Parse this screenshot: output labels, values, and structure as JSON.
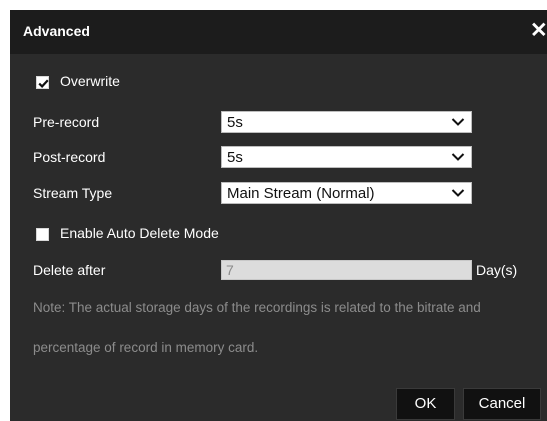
{
  "dialog": {
    "title": "Advanced",
    "close_symbol": "✕"
  },
  "overwrite": {
    "label": "Overwrite",
    "checked": true
  },
  "pre_record": {
    "label": "Pre-record",
    "value": "5s"
  },
  "post_record": {
    "label": "Post-record",
    "value": "5s"
  },
  "stream_type": {
    "label": "Stream Type",
    "value": "Main Stream (Normal)"
  },
  "auto_delete": {
    "label": "Enable Auto Delete Mode",
    "checked": false
  },
  "delete_after": {
    "label": "Delete after",
    "value": "7",
    "unit": "Day(s)"
  },
  "note": {
    "line1": "Note: The actual storage days of the recordings is related to the bitrate and",
    "line2": "percentage of record in memory card."
  },
  "buttons": {
    "ok": "OK",
    "cancel": "Cancel"
  },
  "icons": {
    "check": "check-icon",
    "chevron": "chevron-down-icon",
    "close": "close-icon"
  }
}
